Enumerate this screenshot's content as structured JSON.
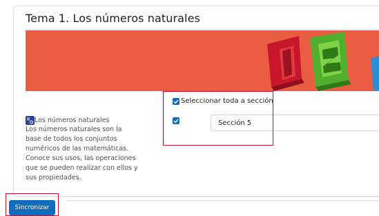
{
  "section": {
    "title": "Tema 1. Los números naturales"
  },
  "banner": {
    "color": "#ea5d43",
    "image": "numbers-1-2-graphic"
  },
  "resource": {
    "icon": "resource-icon",
    "name": "Los números naturales",
    "description": "Los números naturales son la base de todos los conjuntos numéricos de las matemáticas. Conoce sus usos, las operaciones que se pueden realizar con ellos y sus propiedades."
  },
  "selection": {
    "select_all_label": "Seleccionar toda a sección",
    "select_all_checked": true,
    "item_checked": true,
    "target_section": "Sección 5"
  },
  "actions": {
    "sync_label": "Sincronizar"
  },
  "colors": {
    "primary": "#0f6cbf",
    "highlight": "#c8102e"
  }
}
